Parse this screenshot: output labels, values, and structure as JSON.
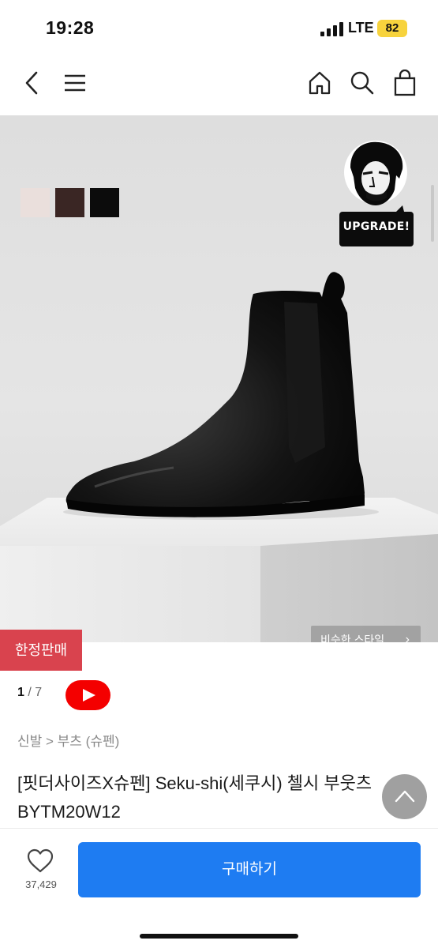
{
  "status_bar": {
    "time": "19:28",
    "network": "LTE",
    "battery": "82"
  },
  "nav": {
    "icons": [
      "back-icon",
      "menu-icon",
      "home-icon",
      "search-icon",
      "cart-icon"
    ]
  },
  "product_image": {
    "swatch_colors": [
      "#eadfdc",
      "#3a2624",
      "#0c0c0c"
    ],
    "brand_badge_text": "UPGRADE!",
    "similar_style_label": "비슷한 스타일",
    "limited_badge": "한정판매"
  },
  "pager": {
    "current": "1",
    "total": "/ 7"
  },
  "breadcrumb": "신발 > 부츠 (슈펜)",
  "product_title": "[핏더사이즈X슈펜] Seku-shi(세쿠시) 첼시 부웃츠 BYTM20W12",
  "bottom_bar": {
    "like_count": "37,429",
    "buy_label": "구매하기"
  },
  "colors": {
    "buy_button": "#1e7cf2",
    "limited_badge": "#d9434e",
    "youtube": "#f40000"
  }
}
